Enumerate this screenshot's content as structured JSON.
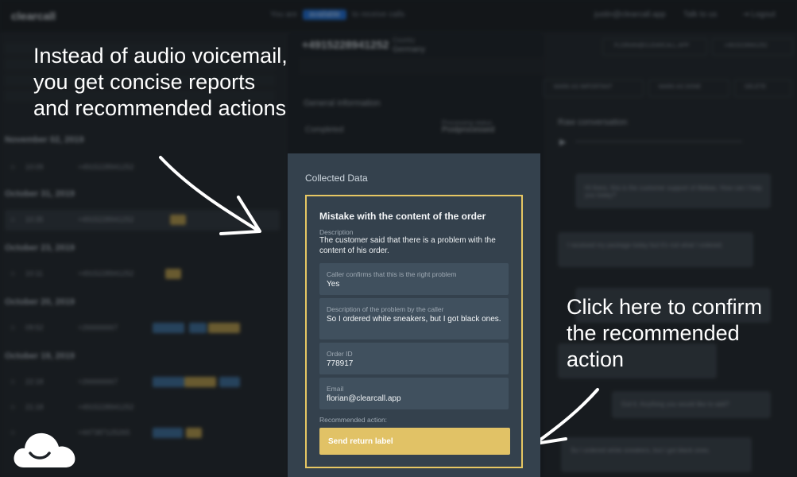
{
  "app": {
    "brand": "clearcall",
    "availability_prefix": "You are",
    "availability_status": "available",
    "availability_suffix": "to receive calls",
    "user_email": "justin@clearcall.app",
    "talk_to_us": "Talk to us",
    "logout": "Logout"
  },
  "calls": {
    "groups": [
      {
        "date": "November 02, 2019",
        "items": [
          {
            "time": "10:09",
            "number": "+4915228941252"
          }
        ]
      },
      {
        "date": "October 31, 2019",
        "items": [
          {
            "time": "10:35",
            "number": "+4915228941252"
          }
        ]
      },
      {
        "date": "October 23, 2019",
        "items": [
          {
            "time": "10:11",
            "number": "+4915228941252"
          }
        ]
      },
      {
        "date": "October 20, 2019",
        "items": [
          {
            "time": "09:52",
            "number": "+266666667"
          }
        ]
      },
      {
        "date": "October 19, 2019",
        "items": [
          {
            "time": "22:18",
            "number": "+266666667"
          },
          {
            "time": "21:18",
            "number": "+4915228941252"
          },
          {
            "time": "",
            "number": "+447387125265"
          }
        ]
      }
    ]
  },
  "detail": {
    "phone": "+4915228941252",
    "country_label": "Country",
    "country": "Germany",
    "general_information": "General information",
    "processing_label": "Processing status",
    "processing_value": "Postprocessed",
    "status_value": "Completed",
    "raw_conversation": "Raw conversation",
    "email_button": "FLORIAN@CLEARCALL.APP",
    "phone_button": "+4915228941252",
    "actions": [
      "MARK AS IMPORTANT",
      "MARK AS DONE",
      "DELETE"
    ],
    "messages": [
      "Hi there, this is the customer support of Abibas. How can I help you today?",
      "I received my package today but it's not what I ordered.",
      "Got it. Anything you would like to add?",
      "So I ordered white sneakers, but I got black ones."
    ]
  },
  "captions": {
    "top_left": [
      "Instead of audio voicemail,",
      "you get concise reports",
      "and recommended actions"
    ],
    "right": [
      "Click here to confirm",
      "the recommended",
      "action"
    ]
  },
  "panel": {
    "title": "Collected Data",
    "card_title": "Mistake with the content of the order",
    "description_label": "Description",
    "description": "The customer said that there is a problem with the content of his order.",
    "fields": [
      {
        "label": "Caller confirms that this is the right problem",
        "value": "Yes"
      },
      {
        "label": "Description of the problem by the caller",
        "value": "So I ordered white sneakers, but I got black ones."
      },
      {
        "label": "Order ID",
        "value": "778917"
      },
      {
        "label": "Email",
        "value": "florian@clearcall.app"
      }
    ],
    "recommended_label": "Recommended action:",
    "action_button": "Send return label"
  },
  "colors": {
    "accent_gold": "#e7c763",
    "button_gold": "#e1c266",
    "panel_bg": "#34414d",
    "field_bg": "#40505e",
    "available_blue": "#1f6fd6"
  },
  "icons": [
    "star-icon",
    "play-icon",
    "cloud-logo-icon",
    "logout-icon"
  ]
}
